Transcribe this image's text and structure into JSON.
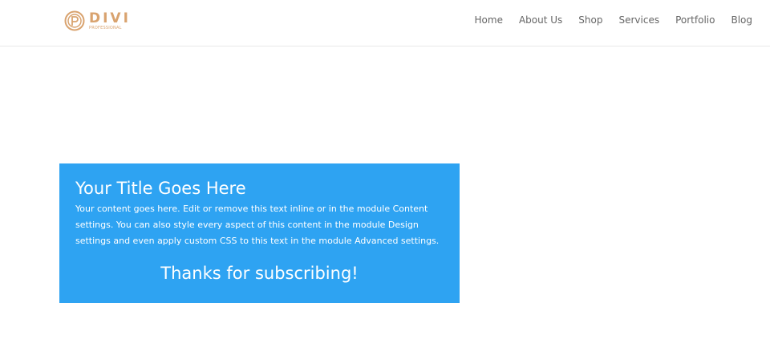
{
  "header": {
    "logo": {
      "word": "DIVI",
      "sub": "PROFESSIONAL",
      "color": "#d9a36f"
    },
    "nav": [
      "Home",
      "About Us",
      "Shop",
      "Services",
      "Portfolio",
      "Blog"
    ]
  },
  "module": {
    "bg_color": "#2ea3f2",
    "title": "Your Title Goes Here",
    "content": "Your content goes here. Edit or remove this text inline or in the module Content settings. You can also style every aspect of this content in the module Design settings and even apply custom CSS to this text in the module Advanced settings.",
    "message": "Thanks for subscribing!"
  }
}
